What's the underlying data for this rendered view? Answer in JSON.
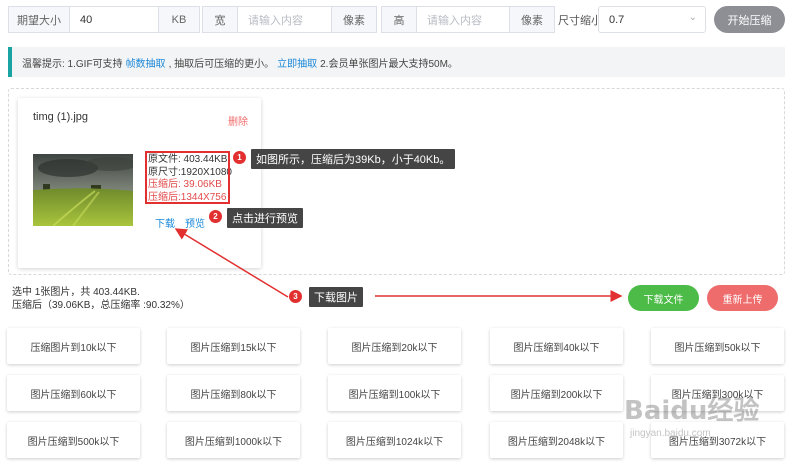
{
  "topbar": {
    "size_label": "期望大小",
    "size_value": "40",
    "size_unit": "KB",
    "width_label": "宽",
    "width_placeholder": "请输入内容",
    "width_unit": "像素",
    "height_label": "高",
    "height_placeholder": "请输入内容",
    "height_unit": "像素",
    "scale_label": "尺寸缩小",
    "scale_value": "0.7",
    "start_button": "开始压缩"
  },
  "tip": {
    "prefix": "温馨提示: 1.GIF可支持",
    "link1": "帧数抽取",
    "middle": ", 抽取后可压缩的更小。",
    "link2": "立即抽取",
    "suffix": "2.会员单张图片最大支持50M。"
  },
  "file": {
    "name": "timg (1).jpg",
    "delete": "删除",
    "orig_size": "原文件: 403.44KB",
    "orig_dims": "原尺寸:1920X1080",
    "comp_size": "压缩后: 39.06KB",
    "comp_dims": "压缩后:1344X756",
    "download": "下载",
    "preview": "预览"
  },
  "annotations": {
    "n1": "1",
    "n2": "2",
    "n3": "3",
    "note1": "如图所示，压缩后为39Kb，小于40Kb。",
    "note2": "点击进行预览",
    "note3": "下载图片"
  },
  "summary": {
    "line1": "选中 1张图片，共 403.44KB.",
    "line2": "压缩后（39.06KB，总压缩率 :90.32%）"
  },
  "actions": {
    "download_files": "下载文件",
    "reupload": "重新上传"
  },
  "presets": [
    "压缩图片到10k以下",
    "图片压缩到15k以下",
    "图片压缩到20k以下",
    "图片压缩到40k以下",
    "图片压缩到50k以下",
    "图片压缩到60k以下",
    "图片压缩到80k以下",
    "图片压缩到100k以下",
    "图片压缩到200k以下",
    "图片压缩到300k以下",
    "图片压缩到500k以下",
    "图片压缩到1000k以下",
    "图片压缩到1024k以下",
    "图片压缩到2048k以下",
    "图片压缩到3072k以下"
  ],
  "watermark": {
    "brand": "Baidu经验",
    "url": "jingyan.baidu.com"
  },
  "colors": {
    "accent_teal": "#1aa3a3",
    "link_blue": "#1a88d8",
    "annotation_red": "#e23030",
    "download_green": "#4cbb47",
    "reupload_red": "#ee6c6c"
  }
}
